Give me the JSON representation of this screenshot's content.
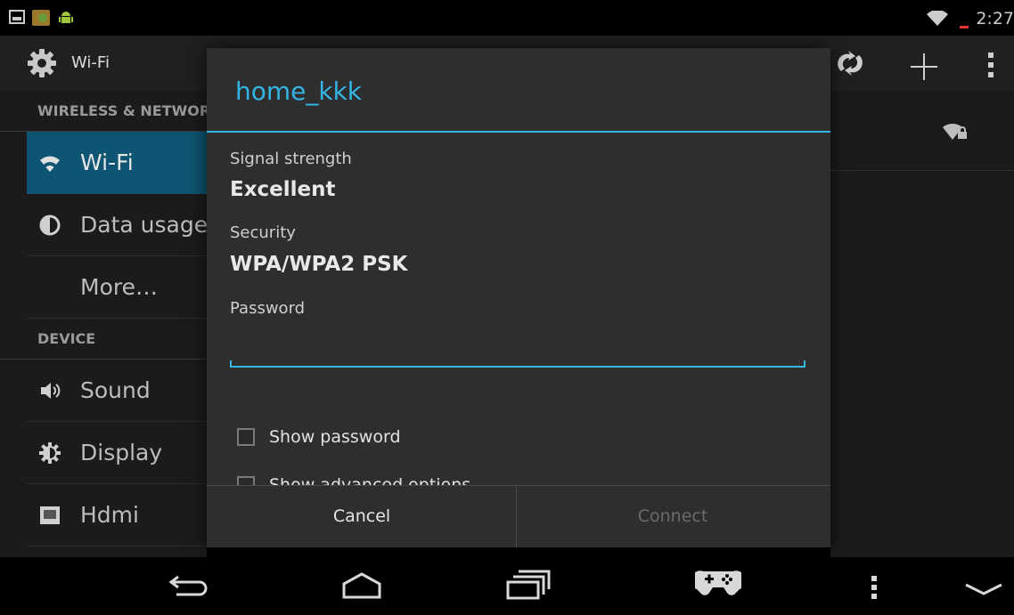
{
  "status_bar": {
    "time": "2:27",
    "icons": [
      "screenshot-icon",
      "app-icon",
      "android-debug-icon",
      "wifi-signal-icon",
      "battery-low-icon"
    ]
  },
  "action_bar": {
    "title": "Wi-Fi",
    "icons": [
      "settings-gear-icon",
      "wps-icon",
      "add-icon",
      "overflow-menu-icon"
    ]
  },
  "sidebar": {
    "sections": [
      {
        "title": "WIRELESS & NETWORKS"
      },
      {
        "title": "DEVICE"
      }
    ],
    "items": [
      {
        "label": "Wi-Fi",
        "icon": "wifi-icon"
      },
      {
        "label": "Data usage",
        "icon": "data-usage-icon"
      },
      {
        "label": "More…",
        "icon": ""
      },
      {
        "label": "Sound",
        "icon": "volume-icon"
      },
      {
        "label": "Display",
        "icon": "brightness-icon"
      },
      {
        "label": "Hdmi",
        "icon": "hdmi-icon"
      }
    ]
  },
  "dialog": {
    "title": "home_kkk",
    "signal_label": "Signal strength",
    "signal_value": "Excellent",
    "security_label": "Security",
    "security_value": "WPA/WPA2 PSK",
    "password_label": "Password",
    "password_value": "",
    "show_password_label": "Show password",
    "show_advanced_label": "Show advanced options",
    "cancel_label": "Cancel",
    "connect_label": "Connect"
  },
  "colors": {
    "accent": "#33b5e5",
    "selected_item": "#0d5572"
  }
}
